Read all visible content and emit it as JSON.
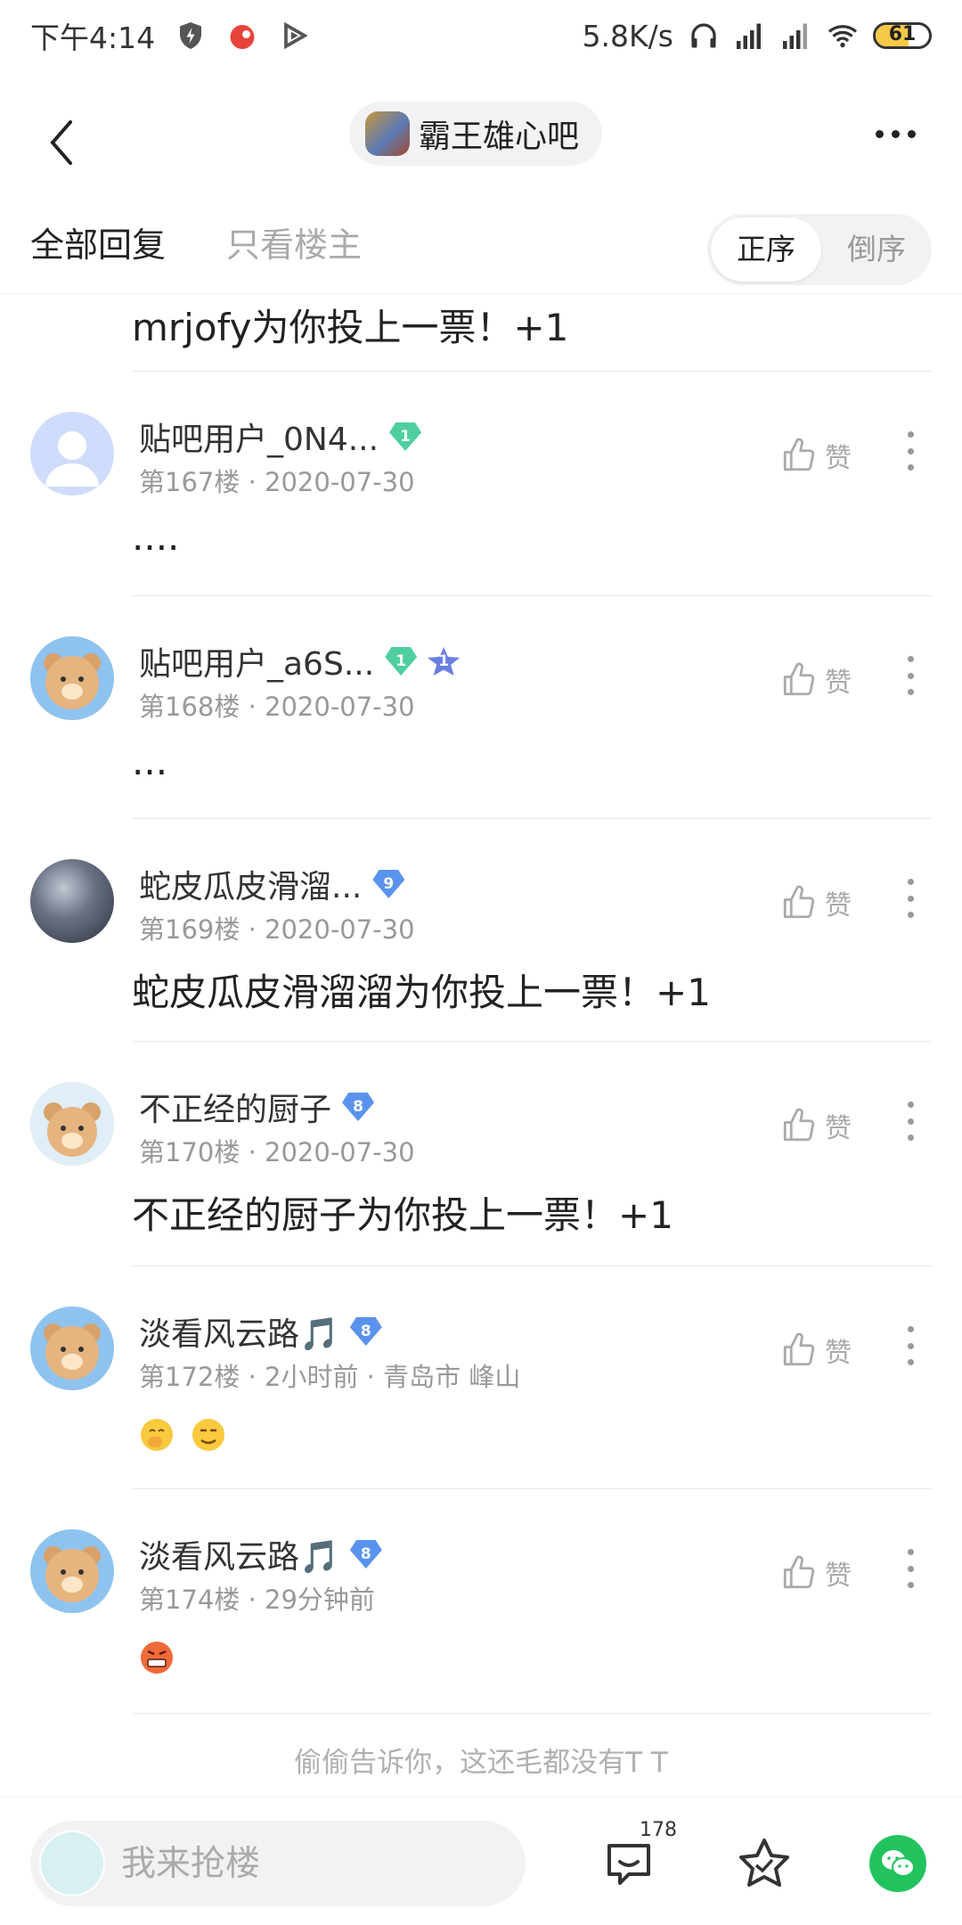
{
  "status_bar": {
    "time": "下午4:14",
    "net_speed": "5.8K/s",
    "battery": "61",
    "battery_level": 0.61
  },
  "header": {
    "forum_name": "霸王雄心吧"
  },
  "tabs": {
    "all": "全部回复",
    "op_only": "只看楼主"
  },
  "sort": {
    "asc": "正序",
    "desc": "倒序"
  },
  "first_post_text": "mrjofy为你投上一票！+1",
  "like_label": "赞",
  "posts": [
    {
      "name": "贴吧用户_0N4...",
      "badge": "1",
      "floor": "第167楼",
      "time": "2020-07-30",
      "body": "...."
    },
    {
      "name": "贴吧用户_a6S...",
      "badge": "1",
      "badge2": "1",
      "floor": "第168楼",
      "time": "2020-07-30",
      "body": "..."
    },
    {
      "name": "蛇皮瓜皮滑溜...",
      "badge": "9",
      "floor": "第169楼",
      "time": "2020-07-30",
      "body": "蛇皮瓜皮滑溜溜为你投上一票！+1"
    },
    {
      "name": "不正经的厨子",
      "badge": "8",
      "floor": "第170楼",
      "time": "2020-07-30",
      "body": "不正经的厨子为你投上一票！+1"
    },
    {
      "name": "淡看风云路🎵",
      "badge": "8",
      "floor": "第172楼",
      "time": "2小时前",
      "location": "青岛市 峰山"
    },
    {
      "name": "淡看风云路🎵",
      "badge": "8",
      "floor": "第174楼",
      "time": "29分钟前"
    }
  ],
  "footer_note": "偷偷告诉你，这还毛都没有T T",
  "bottom_bar": {
    "reply_placeholder": "我来抢楼",
    "comment_count": "178"
  }
}
